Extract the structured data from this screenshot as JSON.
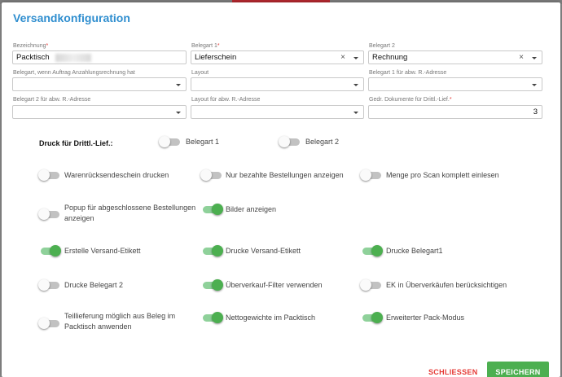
{
  "dialog": {
    "title": "Versandkonfiguration"
  },
  "fields": {
    "bezeichnung": {
      "label": "Bezeichnung",
      "required": "*",
      "value": "Packtisch"
    },
    "belegart1": {
      "label": "Belegart 1",
      "required": "*",
      "value": "Lieferschein"
    },
    "belegart2": {
      "label": "Belegart 2",
      "value": "Rechnung"
    },
    "belegart_anzahlung": {
      "label": "Belegart, wenn Auftrag Anzahlungsrechnung hat",
      "value": ""
    },
    "layout": {
      "label": "Layout",
      "value": ""
    },
    "belegart1_abw": {
      "label": "Belegart 1 für abw. R.-Adresse",
      "value": ""
    },
    "belegart2_abw": {
      "label": "Belegart 2 für abw. R.-Adresse",
      "value": ""
    },
    "layout_abw": {
      "label": "Layout für abw. R.-Adresse",
      "value": ""
    },
    "gedr_dokumente": {
      "label": "Gedr. Dokumente für Drittl.-Lief.",
      "required": "*",
      "value": "3"
    }
  },
  "icons": {
    "clear": "×"
  },
  "druck_drittl": {
    "label": "Druck für Drittl.-Lief.:",
    "toggles": [
      {
        "label": "Belegart 1",
        "on": false
      },
      {
        "label": "Belegart 2",
        "on": false
      }
    ]
  },
  "toggles": [
    {
      "label": "Warenrücksendeschein drucken",
      "on": false
    },
    {
      "label": "Nur bezahlte Bestellungen anzeigen",
      "on": false
    },
    {
      "label": "Menge pro Scan komplett einlesen",
      "on": false
    },
    {
      "label_lines": [
        "Popup für abgeschlossene Bestellungen",
        "anzeigen"
      ],
      "on": false
    },
    {
      "label": "Bilder anzeigen",
      "on": true
    },
    {
      "label": "Erstelle Versand-Etikett",
      "on": true
    },
    {
      "label": "Drucke Versand-Etikett",
      "on": true
    },
    {
      "label": "Drucke Belegart1",
      "on": true
    },
    {
      "label": "Drucke Belegart 2",
      "on": false
    },
    {
      "label": "Überverkauf-Filter verwenden",
      "on": true
    },
    {
      "label": "EK in Überverkäufen berücksichtigen",
      "on": false
    },
    {
      "label_lines": [
        "Teillieferung möglich aus Beleg im",
        "Packtisch anwenden"
      ],
      "on": false
    },
    {
      "label": "Nettogewichte im Packtisch",
      "on": true
    },
    {
      "label": "Erweiterter Pack-Modus",
      "on": true
    }
  ],
  "buttons": {
    "close": "SCHLIESSEN",
    "save": "SPEICHERN"
  },
  "colors": {
    "accent": "#2f8ecf",
    "toggle_on": "#4caf50",
    "close": "#e53935",
    "save_bg": "#4caf50"
  }
}
